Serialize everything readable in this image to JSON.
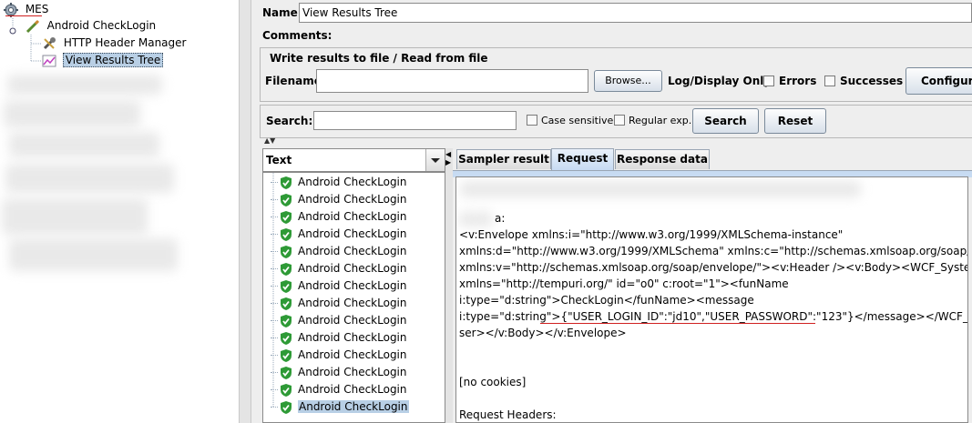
{
  "tree": {
    "root": "MES",
    "thread_group": "Android CheckLogin",
    "header_manager": "HTTP Header Manager",
    "results_tree": "View Results Tree"
  },
  "panel": {
    "name_label": "Name:",
    "name_value": "View Results Tree",
    "comments_label": "Comments:",
    "write_results_title": "Write results to file / Read from file",
    "filename_label": "Filename",
    "filename_value": "",
    "browse_label": "Browse...",
    "log_display_label": "Log/Display Only:",
    "errors_label": "Errors",
    "successes_label": "Successes",
    "configure_label": "Configure",
    "search_label": "Search:",
    "search_value": "",
    "case_sensitive_label": "Case sensitive",
    "regular_exp_label": "Regular exp.",
    "search_button": "Search",
    "reset_button": "Reset"
  },
  "results": {
    "renderer": "Text",
    "samples": [
      "Android CheckLogin",
      "Android CheckLogin",
      "Android CheckLogin",
      "Android CheckLogin",
      "Android CheckLogin",
      "Android CheckLogin",
      "Android CheckLogin",
      "Android CheckLogin",
      "Android CheckLogin",
      "Android CheckLogin",
      "Android CheckLogin",
      "Android CheckLogin",
      "Android CheckLogin",
      "Android CheckLogin"
    ]
  },
  "tabs": [
    "Sampler result",
    "Request",
    "Response data"
  ],
  "request": {
    "line_partial": "a:",
    "lines": [
      "<v:Envelope xmlns:i=\"http://www.w3.org/1999/XMLSchema-instance\"",
      "xmlns:d=\"http://www.w3.org/1999/XMLSchema\" xmlns:c=\"http://schemas.xmlsoap.org/soap/encoding/\"",
      "xmlns:v=\"http://schemas.xmlsoap.org/soap/envelope/\"><v:Header /><v:Body><WCF_SystemUser",
      "xmlns=\"http://tempuri.org/\" id=\"o0\" c:root=\"1\"><funName",
      "i:type=\"d:string\">CheckLogin</funName><message",
      "i:type=\"d:string\">{\"USER_LOGIN_ID\":\"jd10\",\"USER_PASSWORD\":\"123\"}</message></WCF_SystemU",
      "ser></v:Body></v:Envelope>"
    ],
    "cookies": "[no cookies]",
    "headers_label": "Request Headers:"
  },
  "colors": {
    "selection": "#b8cfe5",
    "shield_green": "#2e9a36",
    "underline_red": "#d02020",
    "active_tab": "#c7dbf2"
  }
}
